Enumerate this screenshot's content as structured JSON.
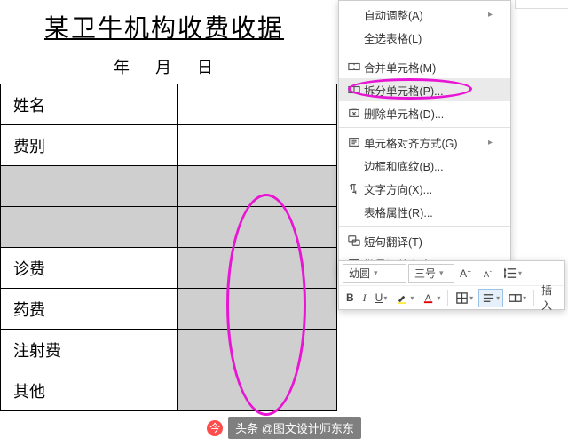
{
  "doc": {
    "title": "某卫牛机构收费收据",
    "date_year": "年",
    "date_month": "月",
    "date_day": "日",
    "rows": {
      "name": "姓名",
      "feetype": "费别",
      "diagnosis": "诊费",
      "medicine": "药费",
      "injection": "注射费",
      "other": "其他"
    }
  },
  "menu": {
    "auto_adjust": "自动调整(A)",
    "select_all_table": "全选表格(L)",
    "merge_cells": "合并单元格(M)",
    "split_cells": "拆分单元格(P)...",
    "delete_cells": "删除单元格(D)...",
    "cell_align": "单元格对齐方式(G)",
    "border_shading": "边框和底纹(B)...",
    "text_direction": "文字方向(X)...",
    "table_props": "表格属性(R)...",
    "phrase_translate": "短句翻译(T)",
    "batch_summary": "批量汇总表格(E)..."
  },
  "toolbar": {
    "font": "幼圆",
    "size": "三号",
    "insert": "插入"
  },
  "watermark": {
    "source": "头条",
    "author": "@图文设计师东东"
  }
}
